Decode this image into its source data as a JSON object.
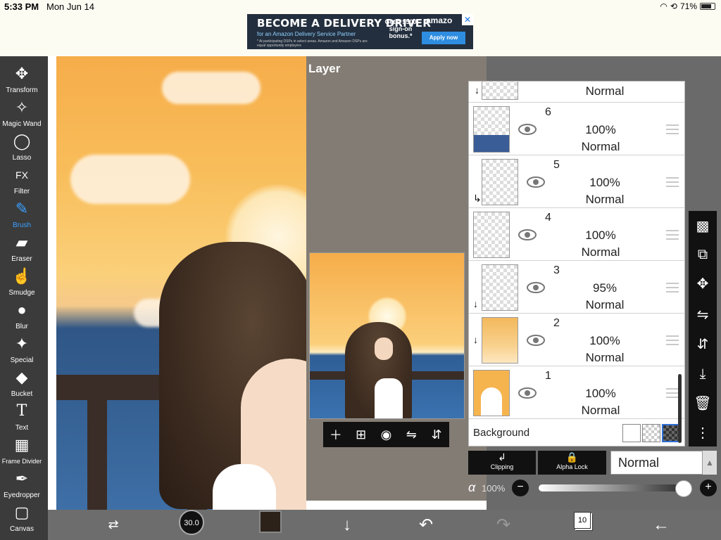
{
  "status": {
    "time": "5:33 PM",
    "date": "Mon Jun 14",
    "battery": "71%"
  },
  "ad": {
    "title": "BECOME A DELIVERY DRIVER",
    "subtitle": "for an Amazon Delivery Service Partner",
    "fine_print": "* At participating DSPs in select areas. Amazon and Amazon DSPs are equal opportunity employers",
    "bonus": "Get a $500 sign-on bonus.*",
    "brand": "amazo",
    "apply": "Apply now"
  },
  "tools": [
    {
      "label": "Transform",
      "icon": "move-arrows-icon",
      "glyph": "✥"
    },
    {
      "label": "Magic Wand",
      "icon": "magic-wand-icon",
      "glyph": "✧"
    },
    {
      "label": "Lasso",
      "icon": "lasso-icon",
      "glyph": "◯"
    },
    {
      "label": "Filter",
      "icon": "fx-icon",
      "glyph": "FX"
    },
    {
      "label": "Brush",
      "icon": "brush-icon",
      "glyph": "✎",
      "active": true
    },
    {
      "label": "Eraser",
      "icon": "eraser-icon",
      "glyph": "▰"
    },
    {
      "label": "Smudge",
      "icon": "smudge-icon",
      "glyph": "☝"
    },
    {
      "label": "Blur",
      "icon": "drop-icon",
      "glyph": "💧"
    },
    {
      "label": "Special",
      "icon": "sparkle-wand-icon",
      "glyph": "✨"
    },
    {
      "label": "Bucket",
      "icon": "bucket-icon",
      "glyph": "◆"
    },
    {
      "label": "Text",
      "icon": "text-icon",
      "glyph": "T"
    },
    {
      "label": "Frame Divider",
      "icon": "frame-divider-icon",
      "glyph": "▦"
    },
    {
      "label": "Eyedropper",
      "icon": "eyedropper-icon",
      "glyph": "✒"
    },
    {
      "label": "Canvas",
      "icon": "canvas-icon",
      "glyph": "▢"
    }
  ],
  "layer_panel": {
    "title": "Layer",
    "top_partial_blend": "Normal",
    "layers": [
      {
        "number": "6",
        "opacity": "100%",
        "blend": "Normal",
        "clipped": false
      },
      {
        "number": "5",
        "opacity": "100%",
        "blend": "Normal",
        "clipped": true
      },
      {
        "number": "4",
        "opacity": "100%",
        "blend": "Normal",
        "clipped": false
      },
      {
        "number": "3",
        "opacity": "95%",
        "blend": "Normal",
        "clipped": true
      },
      {
        "number": "2",
        "opacity": "100%",
        "blend": "Normal",
        "clipped": true
      },
      {
        "number": "1",
        "opacity": "100%",
        "blend": "Normal",
        "clipped": false
      }
    ],
    "background_label": "Background"
  },
  "controls": {
    "clipping": "Clipping",
    "alpha_lock": "Alpha Lock",
    "blend_mode": "Normal",
    "alpha_symbol": "α",
    "alpha_value": "100%",
    "alpha_fraction": 1.0
  },
  "bottom": {
    "brush_size": "30.0",
    "pages": "10",
    "color": "#2c2219"
  }
}
